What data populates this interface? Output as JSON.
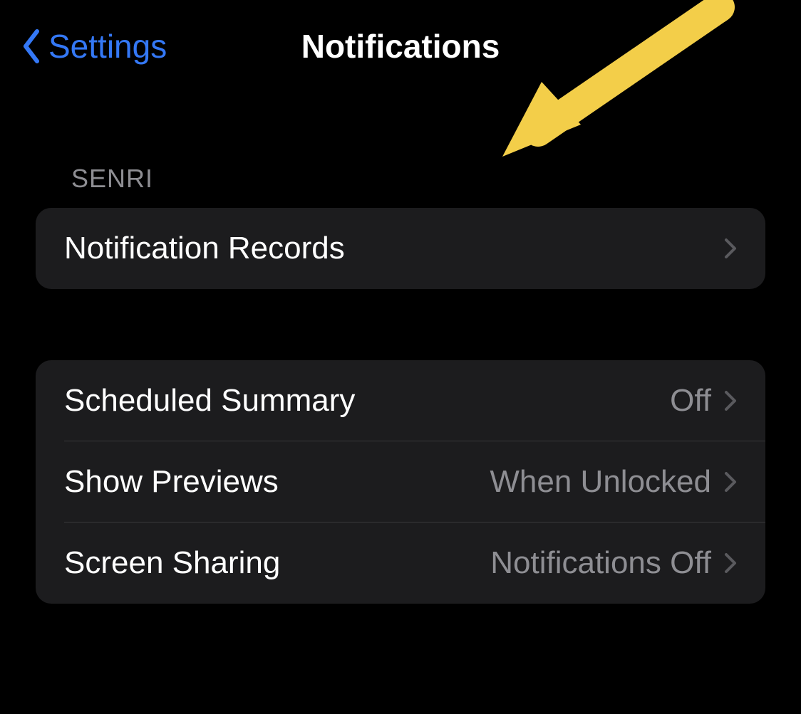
{
  "header": {
    "back_label": "Settings",
    "title": "Notifications"
  },
  "sections": {
    "senri": {
      "header": "SENRI",
      "items": [
        {
          "label": "Notification Records"
        }
      ]
    },
    "settings": {
      "items": [
        {
          "label": "Scheduled Summary",
          "value": "Off"
        },
        {
          "label": "Show Previews",
          "value": "When Unlocked"
        },
        {
          "label": "Screen Sharing",
          "value": "Notifications Off"
        }
      ]
    }
  },
  "colors": {
    "accent": "#3478f6",
    "arrow": "#f3ce49"
  }
}
